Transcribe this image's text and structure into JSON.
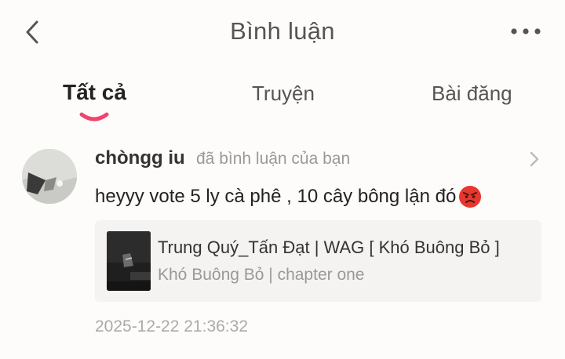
{
  "header": {
    "title": "Bình luận",
    "back_icon": "chevron-left-icon",
    "more_icon": "more-horizontal-icon"
  },
  "tabs": [
    {
      "label": "Tất cả",
      "active": true
    },
    {
      "label": "Truyện",
      "active": false
    },
    {
      "label": "Bài đăng",
      "active": false
    }
  ],
  "colors": {
    "accent": "#f0436f",
    "background": "#fdfcfa",
    "card_background": "#f4f3f1"
  },
  "comment": {
    "username": "chòngg iu",
    "action_text": "đã bình luận của bạn",
    "text": "heyyy vote 5 ly cà phê , 10 cây bông lận đó",
    "emoji": "angry-face-emoji",
    "story": {
      "title": "Trung Quý_Tấn Đạt | WAG [ Khó Buông Bỏ ]",
      "subtitle": "Khó Buông Bỏ | chapter one"
    },
    "timestamp": "2025-12-22 21:36:32"
  }
}
